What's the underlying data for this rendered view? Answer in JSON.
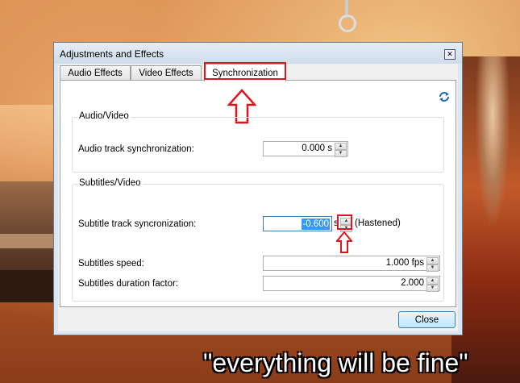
{
  "window": {
    "title": "Adjustments and Effects",
    "close_glyph": "✕"
  },
  "tabs": [
    {
      "label": "Audio Effects"
    },
    {
      "label": "Video Effects"
    },
    {
      "label": "Synchronization"
    }
  ],
  "audio_video": {
    "group_label": "Audio/Video",
    "audio_sync_label": "Audio track synchronization:",
    "audio_sync_value": "0.000 s"
  },
  "subtitles_video": {
    "group_label": "Subtitles/Video",
    "subtitle_sync_label": "Subtitle track syncronization:",
    "subtitle_sync_value": "-0.600",
    "subtitle_sync_unit": "s",
    "subtitle_sync_status": "(Hastened)",
    "speed_label": "Subtitles speed:",
    "speed_value": "1.000 fps",
    "duration_label": "Subtitles duration factor:",
    "duration_value": "2.000"
  },
  "footer": {
    "close_label": "Close"
  },
  "caption": "\"everything will be fine\"",
  "icons": {
    "sync": "sync-refresh-icon",
    "annotation_arrows": "red-up-arrow-icon"
  },
  "colors": {
    "highlight_red": "#e0141c",
    "selection_blue": "#3399ff"
  }
}
